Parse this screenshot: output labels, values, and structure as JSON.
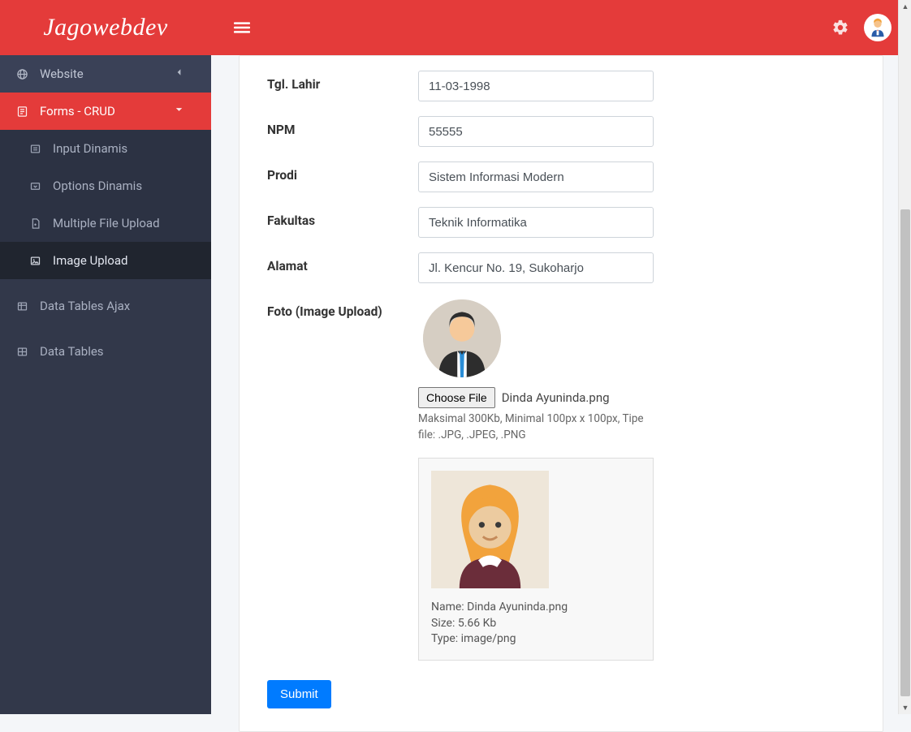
{
  "brand": "Jagowebdev",
  "sidebar": {
    "website": "Website",
    "forms": "Forms - CRUD",
    "sub": {
      "input_dinamis": "Input Dinamis",
      "options_dinamis": "Options Dinamis",
      "multi_upload": "Multiple File Upload",
      "image_upload": "Image Upload"
    },
    "data_tables_ajax": "Data Tables Ajax",
    "data_tables": "Data Tables"
  },
  "form": {
    "tgl_lahir": {
      "label": "Tgl. Lahir",
      "value": "11-03-1998"
    },
    "npm": {
      "label": "NPM",
      "value": "55555"
    },
    "prodi": {
      "label": "Prodi",
      "value": "Sistem Informasi Modern"
    },
    "fakultas": {
      "label": "Fakultas",
      "value": "Teknik Informatika"
    },
    "alamat": {
      "label": "Alamat",
      "value": "Jl. Kencur No. 19, Sukoharjo"
    },
    "foto_label": "Foto (Image Upload)",
    "choose_file": "Choose File",
    "file_name": "Dinda Ayuninda.png",
    "hint": "Maksimal 300Kb, Minimal 100px x 100px, Tipe file: .JPG, .JPEG, .PNG",
    "meta": {
      "name_label": "Name: ",
      "name_value": "Dinda Ayuninda.png",
      "size_label": "Size: ",
      "size_value": "5.66 Kb",
      "type_label": "Type: ",
      "type_value": "image/png"
    },
    "submit": "Submit"
  }
}
